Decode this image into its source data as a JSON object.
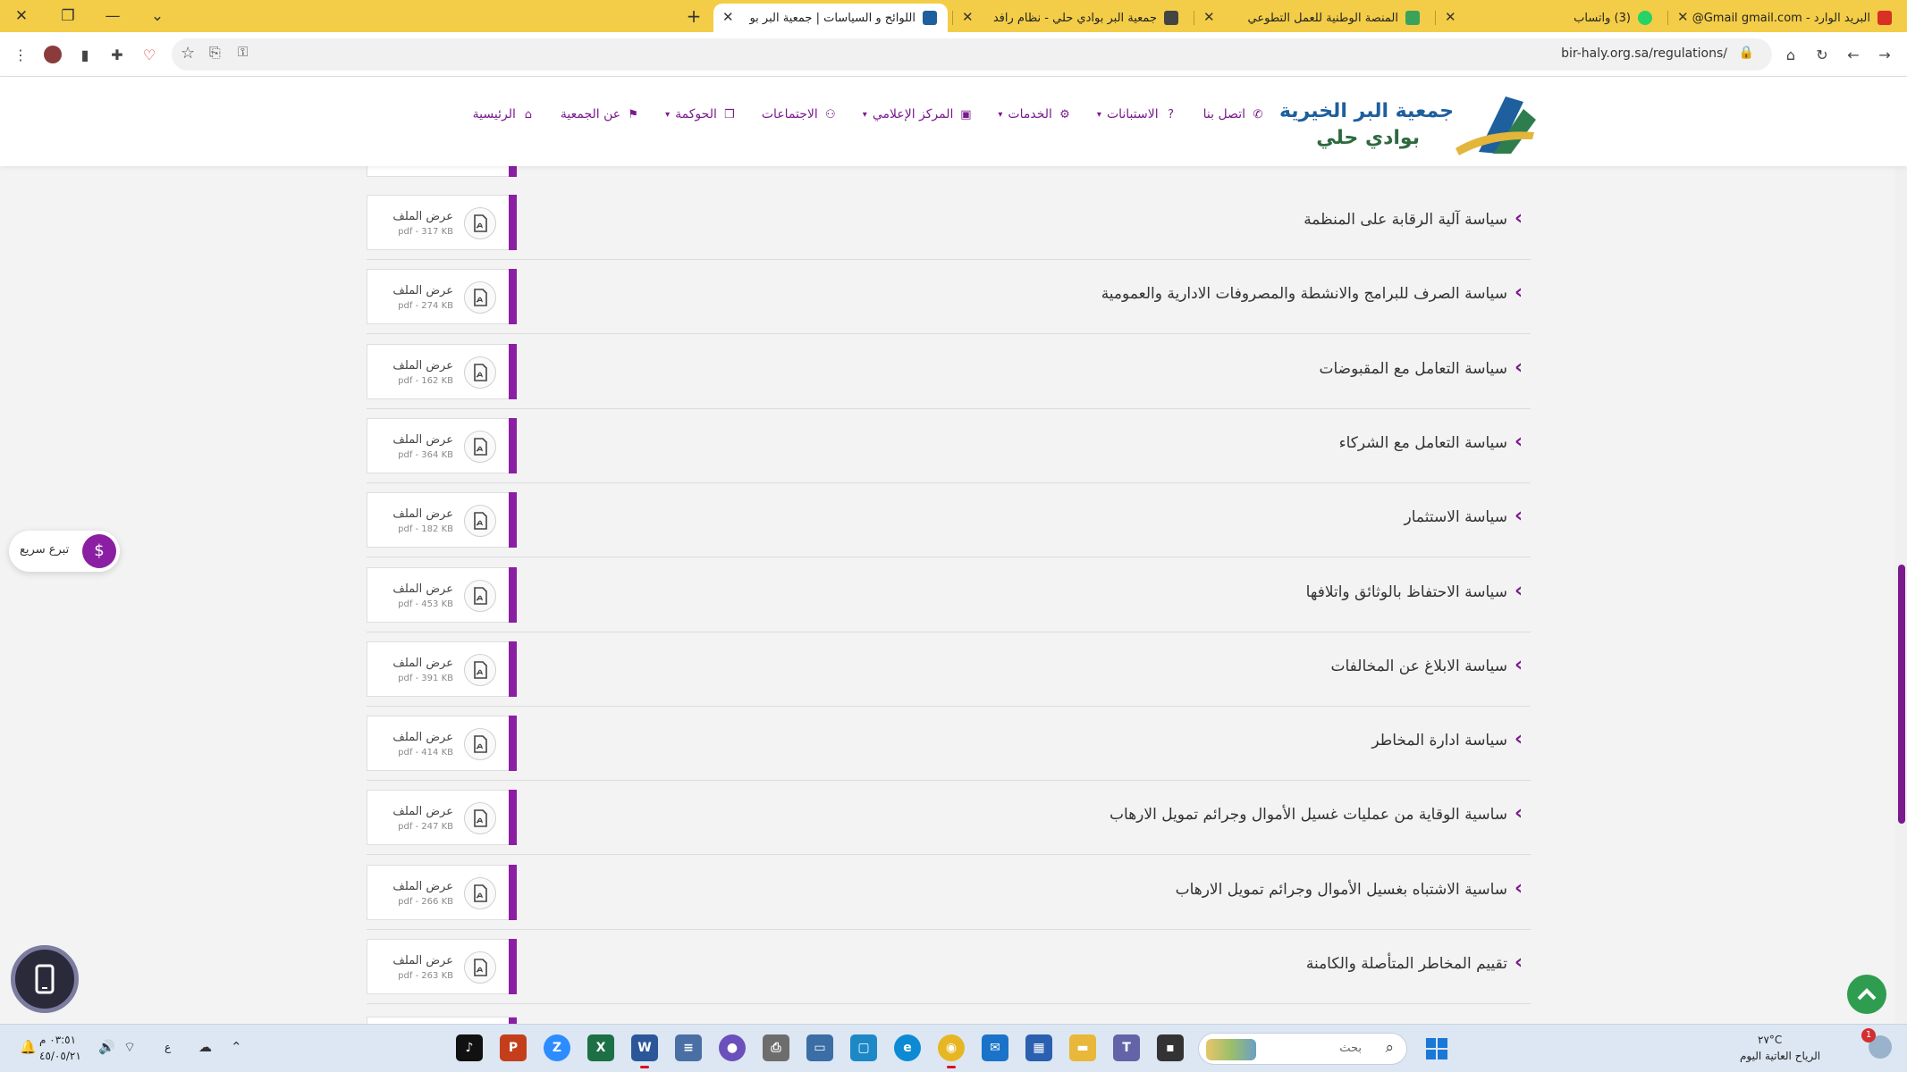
{
  "browser": {
    "tabs": [
      {
        "title": "البريد الوارد - Gmail",
        "account": "gmail.com@",
        "favicon_color": "#d93025",
        "badge": ""
      },
      {
        "title": "(3) واتساب",
        "favicon_color": "#25d366",
        "badge": ""
      },
      {
        "title": "المنصة الوطنية للعمل التطوعي",
        "favicon_color": "#3aa35b",
        "badge": ""
      },
      {
        "title": "جمعية البر بوادي حلي - نظام رافد",
        "favicon_color": "#444444",
        "badge": ""
      },
      {
        "title": "اللوائح و السياسات | جمعية البر بو",
        "favicon_color": "#1e5f9e",
        "badge": ""
      }
    ],
    "new_tab": "+",
    "close_glyph": "✕",
    "url": "bir-haly.org.sa/regulations/"
  },
  "site": {
    "logo_line1": "جمعية البر الخيرية",
    "logo_line2": "بوادي حلي",
    "nav": [
      {
        "label": "الرئيسية",
        "icon": "home-icon",
        "dropdown": false
      },
      {
        "label": "عن الجمعية",
        "icon": "bookmark-icon",
        "dropdown": false
      },
      {
        "label": "الحوكمة",
        "icon": "documents-icon",
        "dropdown": true
      },
      {
        "label": "الاجتماعات",
        "icon": "group-icon",
        "dropdown": false
      },
      {
        "label": "المركز الإعلامي",
        "icon": "media-icon",
        "dropdown": true
      },
      {
        "label": "الخدمات",
        "icon": "services-icon",
        "dropdown": true
      },
      {
        "label": "الاستبانات",
        "icon": "survey-icon",
        "dropdown": true
      },
      {
        "label": "اتصل بنا",
        "icon": "phone-icon",
        "dropdown": false
      }
    ]
  },
  "file_label": "عرض الملف",
  "regulations": [
    {
      "title": "سياسة آلية الرقابة على المنظمة",
      "size": "pdf - 317 KB"
    },
    {
      "title": "سياسة الصرف للبرامج والانشطة والمصروفات الادارية والعمومية",
      "size": "pdf - 274 KB"
    },
    {
      "title": "سياسة التعامل مع المقبوضات",
      "size": "pdf - 162 KB"
    },
    {
      "title": "سياسة التعامل مع الشركاء",
      "size": "pdf - 364 KB"
    },
    {
      "title": "سياسة الاستثمار",
      "size": "pdf - 182 KB"
    },
    {
      "title": "سياسة الاحتفاظ بالوثائق واتلافها",
      "size": "pdf - 453 KB"
    },
    {
      "title": "سياسة الابلاغ عن المخالفات",
      "size": "pdf - 391 KB"
    },
    {
      "title": "سياسة ادارة المخاطر",
      "size": "pdf - 414 KB"
    },
    {
      "title": "ساسية الوقاية من عمليات غسيل الأموال وجرائم تمويل الارهاب",
      "size": "pdf - 247 KB"
    },
    {
      "title": "ساسية الاشتباه بغسيل الأموال وجرائم تمويل الارهاب",
      "size": "pdf - 266 KB"
    },
    {
      "title": "تقييم المخاطر المتأصلة والكامنة",
      "size": "pdf - 263 KB"
    }
  ],
  "widgets": {
    "donate_label": "تبرع سريع",
    "accent": "#8b1fa3"
  },
  "taskbar": {
    "search_placeholder": "بحث",
    "weather_temp": "٢٧°C",
    "weather_desc": "الرياح العاتية اليوم",
    "notification_count": "1",
    "clock_time": "٠٣:٥١ م",
    "clock_date": "٤٥/٠٥/٢١",
    "lang": "ع"
  }
}
